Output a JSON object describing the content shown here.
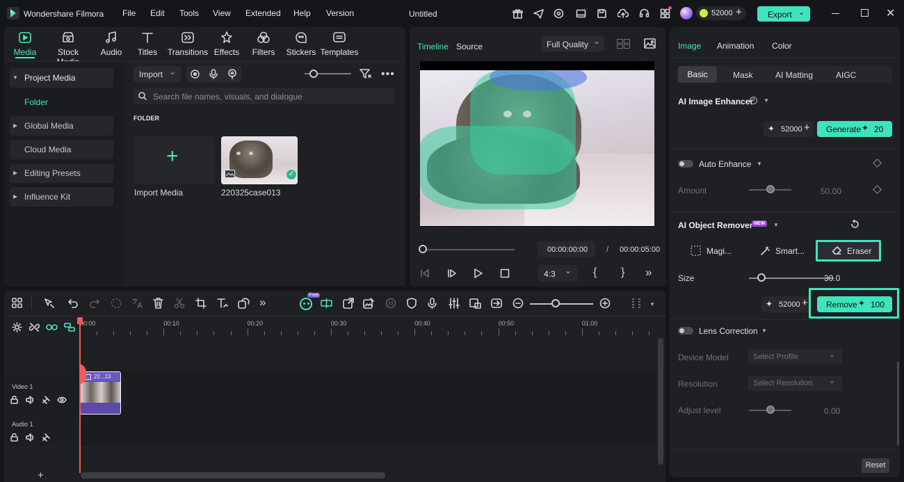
{
  "app": {
    "name": "Wondershare Filmora",
    "doc_title": "Untitled",
    "menu": [
      "File",
      "Edit",
      "Tools",
      "View",
      "Extended",
      "Help",
      "Version"
    ],
    "credits": "52000",
    "export_label": "Export"
  },
  "media_tabs": [
    "Media",
    "Stock Media",
    "Audio",
    "Titles",
    "Transitions",
    "Effects",
    "Filters",
    "Stickers",
    "Templates"
  ],
  "sidebar": {
    "items": [
      {
        "label": "Project Media"
      },
      {
        "label": "Folder"
      },
      {
        "label": "Global Media"
      },
      {
        "label": "Cloud Media"
      },
      {
        "label": "Editing Presets"
      },
      {
        "label": "Influence Kit"
      }
    ]
  },
  "library": {
    "import_label": "Import",
    "search_placeholder": "Search file names, visuals, and dialogue",
    "folder_heading": "FOLDER",
    "import_media_label": "Import Media",
    "clip_name": "220325case013"
  },
  "preview": {
    "tab_timeline": "Timeline",
    "tab_source": "Source",
    "quality": "Full Quality",
    "current_time": "00:00:00:00",
    "separator": "/",
    "total_time": "00:00:05:00",
    "aspect": "4:3"
  },
  "inspector": {
    "tabs": [
      "Image",
      "Animation",
      "Color"
    ],
    "subtabs": [
      "Basic",
      "Mask",
      "AI Matting",
      "AIGC"
    ],
    "enhancer": {
      "title": "AI Image Enhancer",
      "credits": "52000",
      "generate_label": "Generate",
      "generate_cost": "20"
    },
    "auto_enhance": {
      "label": "Auto Enhance",
      "amount_label": "Amount",
      "amount_value": "50.00",
      "amount_fraction": 0.5
    },
    "object_remover": {
      "title": "AI Object Remover",
      "badge": "NEW",
      "tools": [
        "Magi...",
        "Smart...",
        "Eraser"
      ],
      "size_label": "Size",
      "size_value": "30.0",
      "size_fraction": 0.15,
      "credits": "52000",
      "remove_label": "Remove",
      "remove_cost": "100"
    },
    "lens": {
      "label": "Lens Correction",
      "device_label": "Device Model",
      "device_value": "Select Profile",
      "resolution_label": "Resolution",
      "resolution_value": "Select Resolution",
      "adjust_label": "Adjust level",
      "adjust_value": "0.00",
      "adjust_fraction": 0.5
    },
    "reset_label": "Reset"
  },
  "timeline": {
    "ruler": [
      "00:00",
      "00:10",
      "00:20",
      "00:30",
      "00:40",
      "00:50",
      "01:00"
    ],
    "tracks": [
      {
        "label": "Video 1"
      },
      {
        "label": "Audio 1"
      }
    ],
    "clip_label": "22...13",
    "free_badge": "Free"
  },
  "colors": {
    "accent": "#46e6bf",
    "panel": "#1f2024",
    "bg": "#151619",
    "playhead": "#f25a5a",
    "clip": "#5b4aa8"
  }
}
